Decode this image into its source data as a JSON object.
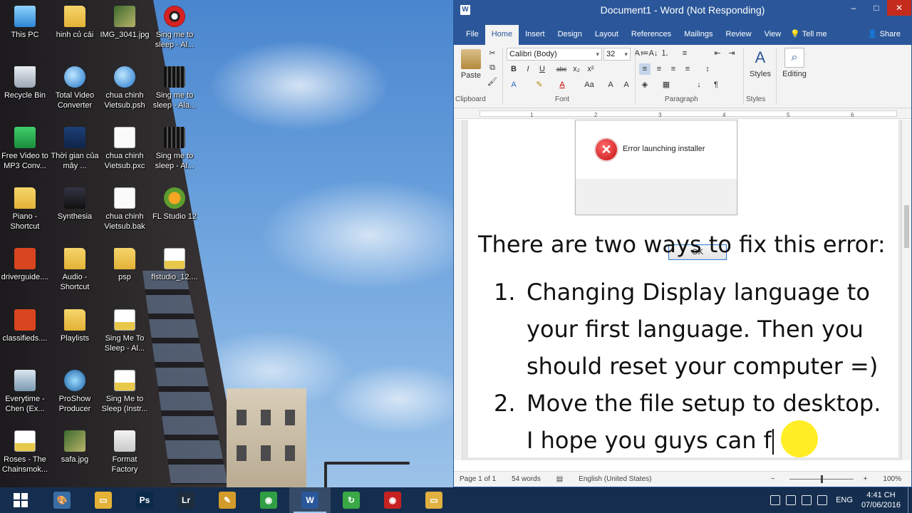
{
  "desktop": {
    "icons": [
      {
        "label": "This PC",
        "icon": "pc"
      },
      {
        "label": "Recycle Bin",
        "icon": "bin"
      },
      {
        "label": "Free Video to MP3 Conv...",
        "icon": "green"
      },
      {
        "label": "Piano - Shortcut",
        "icon": "folder"
      },
      {
        "label": "driverguide....",
        "icon": "office"
      },
      {
        "label": "classifieds....",
        "icon": "office"
      },
      {
        "label": "Everytime - Chen (Ex...",
        "icon": "people"
      },
      {
        "label": "Roses - The Chainsmok...",
        "icon": "pkg"
      },
      {
        "label": "hinh củ cải",
        "icon": "folder"
      },
      {
        "label": "Total Video Converter",
        "icon": "globe"
      },
      {
        "label": "Thời gian của mây ...",
        "icon": "chart"
      },
      {
        "label": "Synthesia",
        "icon": "synth"
      },
      {
        "label": "Audio - Shortcut",
        "icon": "folder"
      },
      {
        "label": "Playlists",
        "icon": "folder"
      },
      {
        "label": "ProShow Producer",
        "icon": "pro"
      },
      {
        "label": "safa.jpg",
        "icon": "photo"
      },
      {
        "label": "IMG_3041.jpg",
        "icon": "photo"
      },
      {
        "label": "chua chinh Vietsub.psh",
        "icon": "globe"
      },
      {
        "label": "chua chinh Vietsub.pxc",
        "icon": "file"
      },
      {
        "label": "chua chinh Vietsub.bak",
        "icon": "file"
      },
      {
        "label": "psp",
        "icon": "folder"
      },
      {
        "label": "Sing Me To Sleep - Al...",
        "icon": "pkg"
      },
      {
        "label": "Sing Me to Sleep (Instr...",
        "icon": "pkg"
      },
      {
        "label": "Format Factory",
        "icon": "cart"
      },
      {
        "label": "Sing me to sleep - Al...",
        "icon": "eye"
      },
      {
        "label": "Sing me to sleep - Ala...",
        "icon": "film"
      },
      {
        "label": "Sing me to sleep - Al...",
        "icon": "film"
      },
      {
        "label": "FL Studio 12",
        "icon": "fl"
      },
      {
        "label": "flstudio_12....",
        "icon": "pkg"
      }
    ]
  },
  "word": {
    "logo": "W",
    "title": "Document1 - Word (Not Responding)",
    "controls": {
      "minimize": "–",
      "maximize": "□",
      "close": "✕"
    },
    "tabs": [
      "File",
      "Home",
      "Insert",
      "Design",
      "Layout",
      "References",
      "Mailings",
      "Review",
      "View"
    ],
    "active_tab": "Home",
    "tell_me": "Tell me",
    "share": "Share",
    "ribbon": {
      "paste_label": "Paste",
      "font_name": "Calibri (Body)",
      "font_size": "32",
      "groups": {
        "clipboard": "Clipboard",
        "font": "Font",
        "paragraph": "Paragraph",
        "styles": "Styles"
      },
      "styles_label": "Styles",
      "editing_label": "Editing",
      "font_buttons": {
        "bold": "B",
        "italic": "I",
        "underline": "U",
        "strike": "abc",
        "sub": "x₂",
        "sup": "x²"
      }
    },
    "ruler_numbers": [
      "1",
      "2",
      "3",
      "4",
      "5",
      "6"
    ],
    "document": {
      "dialog": {
        "message": "Error launching installer",
        "ok": "OK",
        "icon": "error-icon"
      },
      "intro": "There are two ways to fix this error:",
      "items": [
        {
          "num": "1.",
          "text": "Changing Display language to your first language. Then you should reset your computer =)"
        },
        {
          "num": "2.",
          "text": "Move the file setup to desktop."
        }
      ],
      "trailing": "I hope you guys can f"
    },
    "status": {
      "page": "Page 1 of 1",
      "words": "54 words",
      "language": "English (United States)",
      "zoom": "100%"
    }
  },
  "taskbar": {
    "apps": [
      {
        "name": "paint",
        "glyph": "🎨",
        "color": "#3a6ea5"
      },
      {
        "name": "folder",
        "glyph": "▭",
        "color": "#e3b236"
      },
      {
        "name": "photoshop",
        "glyph": "Ps",
        "color": "#0b2a4a"
      },
      {
        "name": "lightroom",
        "glyph": "Lr",
        "color": "#1e2d3d"
      },
      {
        "name": "tool",
        "glyph": "✎",
        "color": "#d39b2a"
      },
      {
        "name": "chrome",
        "glyph": "◉",
        "color": "#2f9e44"
      },
      {
        "name": "word",
        "glyph": "W",
        "color": "#2b579a"
      },
      {
        "name": "green-app",
        "glyph": "↻",
        "color": "#39a845"
      },
      {
        "name": "eye-app",
        "glyph": "◉",
        "color": "#c62222"
      },
      {
        "name": "explorer",
        "glyph": "▭",
        "color": "#e0b040"
      }
    ],
    "active_app": "word",
    "lang": "ENG",
    "time": "4:41 CH",
    "date": "07/06/2016"
  }
}
